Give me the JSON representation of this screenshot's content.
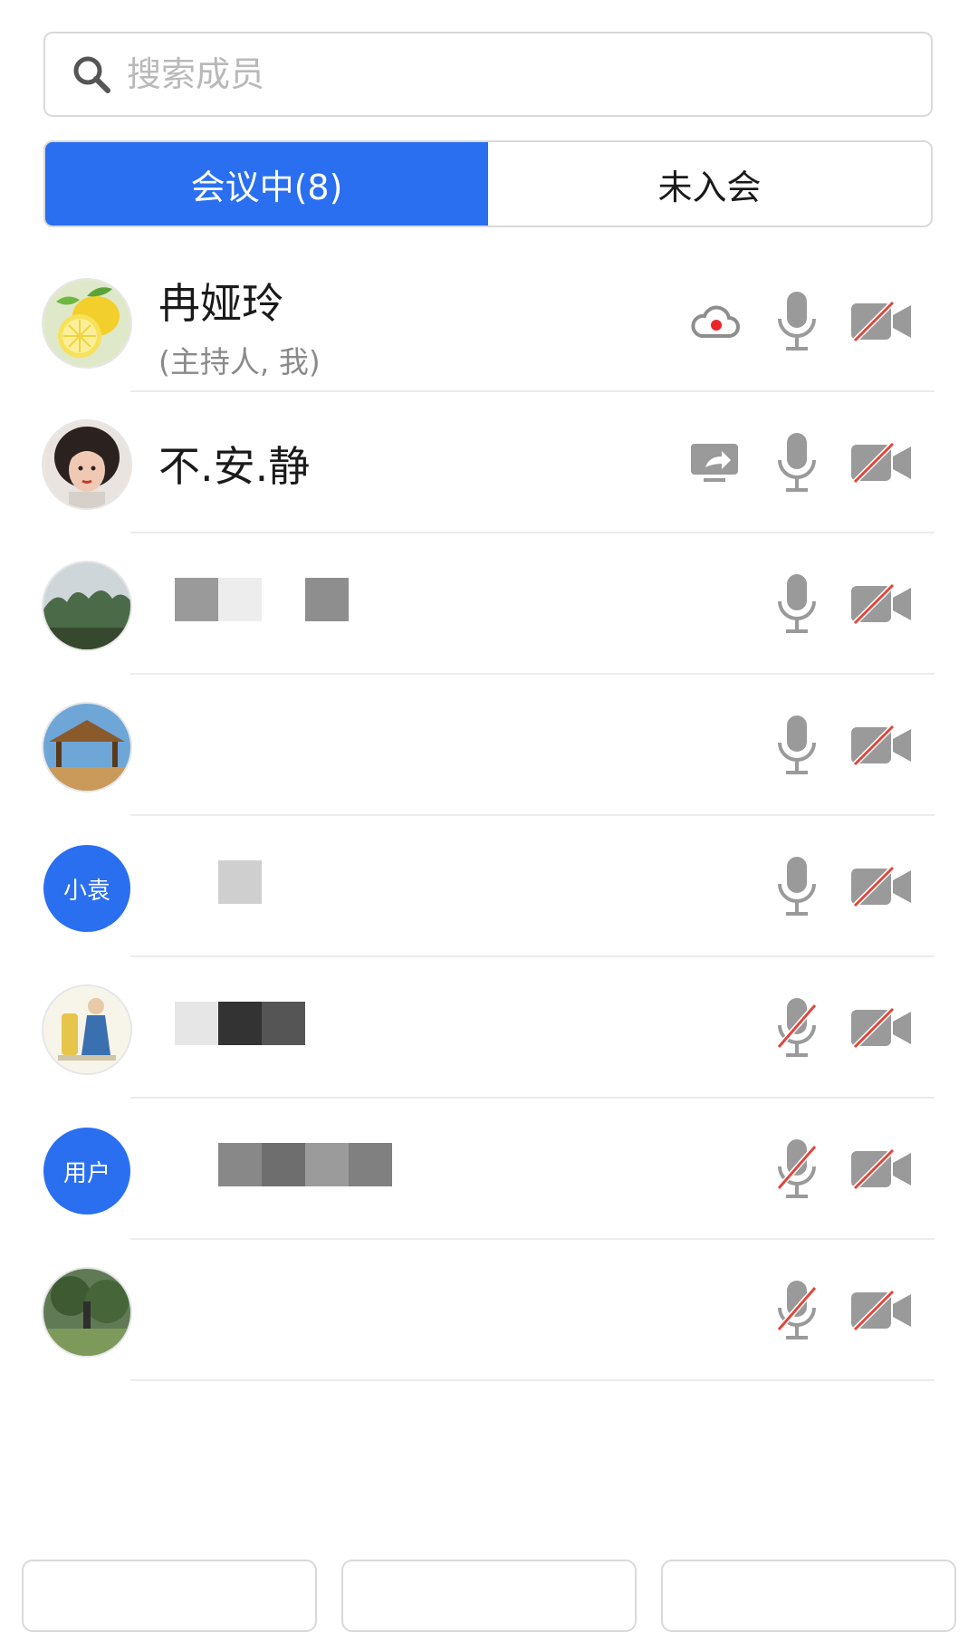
{
  "search": {
    "placeholder": "搜索成员",
    "icon": "search-icon"
  },
  "tabs": [
    {
      "label": "会议中(8)",
      "active": true
    },
    {
      "label": "未入会",
      "active": false
    }
  ],
  "participants": [
    {
      "name": "冉娅玲",
      "subtitle": "(主持人, 我)",
      "avatar": "lemon-photo",
      "status_icon": "cloud-record-icon",
      "mic": "on",
      "camera": "off"
    },
    {
      "name": "不.安.静",
      "avatar": "portrait-photo",
      "status_icon": "screen-share-icon",
      "mic": "on",
      "camera": "off"
    },
    {
      "name": "",
      "avatar": "landscape-photo",
      "mic": "on",
      "camera": "off"
    },
    {
      "name": "",
      "avatar": "pavilion-photo",
      "mic": "on",
      "camera": "off"
    },
    {
      "name": "",
      "avatar_text": "小袁",
      "mic": "on",
      "camera": "off"
    },
    {
      "name": "",
      "avatar": "illustration-photo",
      "mic": "off",
      "camera": "off"
    },
    {
      "name": "",
      "avatar_text": "用户",
      "mic": "off",
      "camera": "off"
    },
    {
      "name": "",
      "avatar": "garden-photo",
      "mic": "off",
      "camera": "off"
    }
  ],
  "colors": {
    "accent": "#2a6ff0",
    "icon_gray": "#9a9a9a",
    "mute_red": "#e0463a",
    "record_red": "#e8262b"
  }
}
